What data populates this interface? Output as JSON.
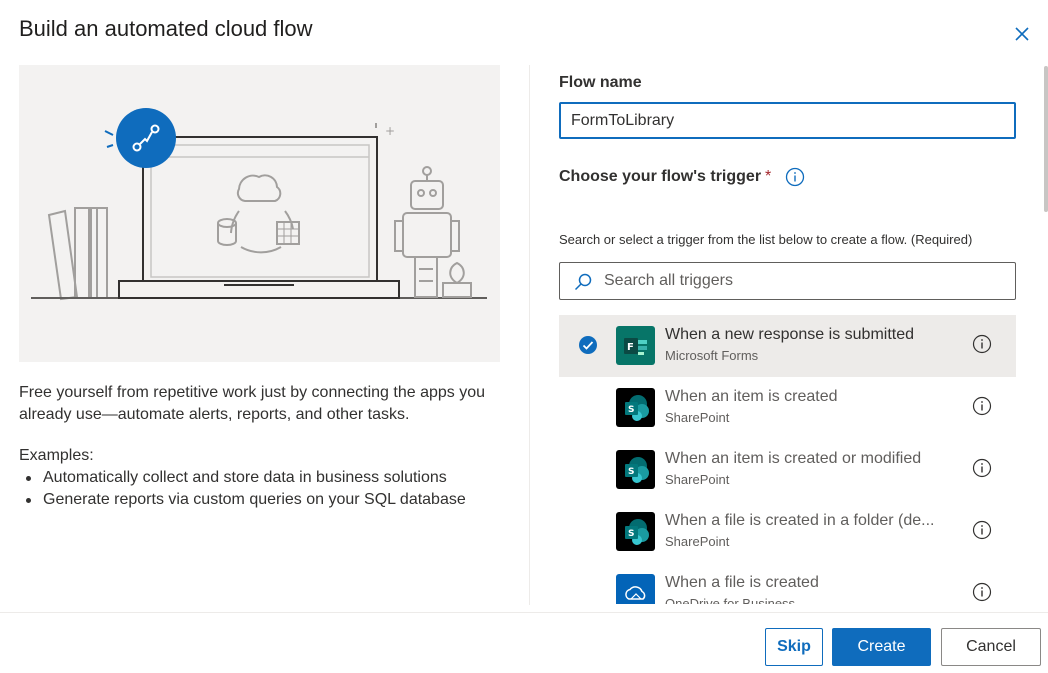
{
  "dialog": {
    "title": "Build an automated cloud flow"
  },
  "left": {
    "description": "Free yourself from repetitive work just by connecting the apps you already use—automate alerts, reports, and other tasks.",
    "examples_label": "Examples:",
    "examples": [
      "Automatically collect and store data in business solutions",
      "Generate reports via custom queries on your SQL database"
    ]
  },
  "form": {
    "flow_name_label": "Flow name",
    "flow_name_value": "FormToLibrary",
    "trigger_label": "Choose your flow's trigger",
    "required_mark": "*",
    "helper_text": "Search or select a trigger from the list below to create a flow. (Required)",
    "search_placeholder": "Search all triggers"
  },
  "triggers": [
    {
      "title": "When a new response is submitted",
      "connector": "Microsoft Forms",
      "icon": "forms-icon",
      "selected": true
    },
    {
      "title": "When an item is created",
      "connector": "SharePoint",
      "icon": "sharepoint-icon",
      "selected": false
    },
    {
      "title": "When an item is created or modified",
      "connector": "SharePoint",
      "icon": "sharepoint-icon",
      "selected": false
    },
    {
      "title": "When a file is created in a folder (de...",
      "connector": "SharePoint",
      "icon": "sharepoint-icon",
      "selected": false
    },
    {
      "title": "When a file is created",
      "connector": "OneDrive for Business",
      "icon": "onedrive-icon",
      "selected": false
    }
  ],
  "buttons": {
    "skip": "Skip",
    "create": "Create",
    "cancel": "Cancel"
  },
  "colors": {
    "accent": "#0f6cbd",
    "forms": "#077568",
    "sharepoint": "#036c70",
    "onedrive": "#0364b8",
    "required": "#a4262c"
  }
}
